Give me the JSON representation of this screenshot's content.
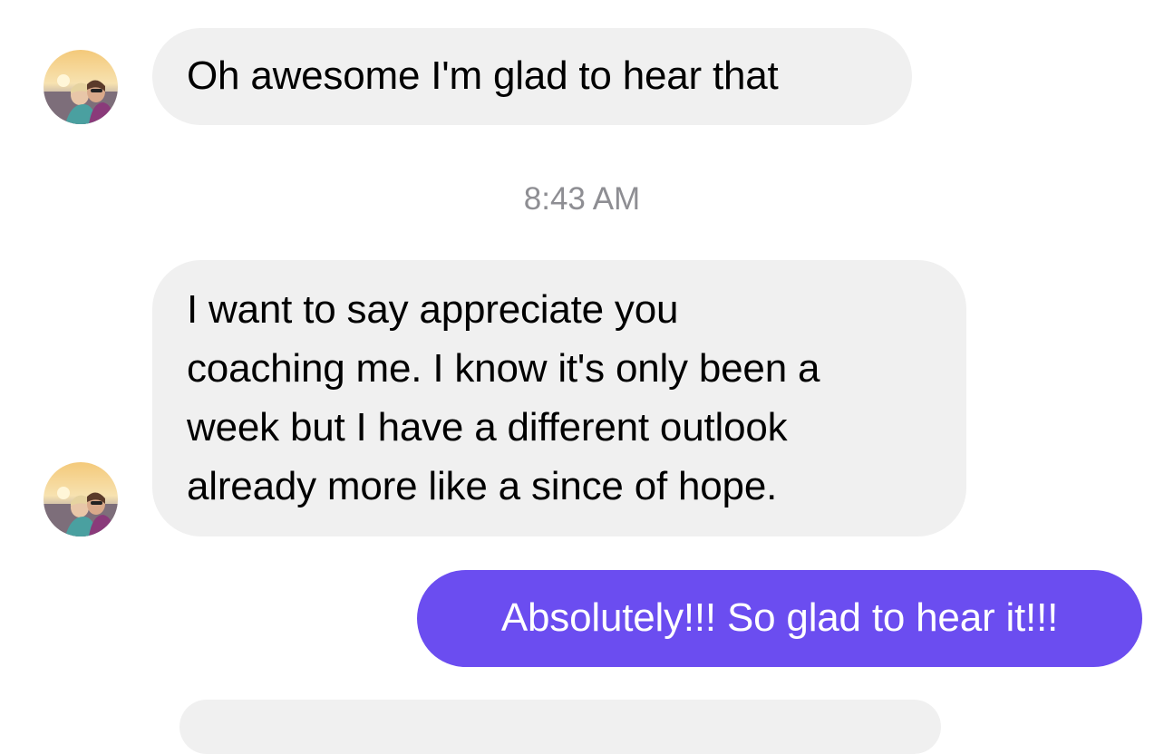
{
  "colors": {
    "incoming_bubble": "#f0f0f0",
    "outgoing_bubble": "#6b4df0",
    "timestamp_text": "#8e8e93"
  },
  "icons": {
    "avatar": "contact-avatar-photo"
  },
  "messages": [
    {
      "direction": "incoming",
      "text": "Oh awesome I'm glad to hear that"
    },
    {
      "direction": "incoming",
      "lines": [
        "I want to say appreciate you",
        "coaching me. I know it's only been a",
        "week but I have a different outlook",
        "already more like a since of hope."
      ]
    },
    {
      "direction": "outgoing",
      "text": "Absolutely!!! So glad to hear it!!!"
    }
  ],
  "timestamp": "8:43 AM"
}
